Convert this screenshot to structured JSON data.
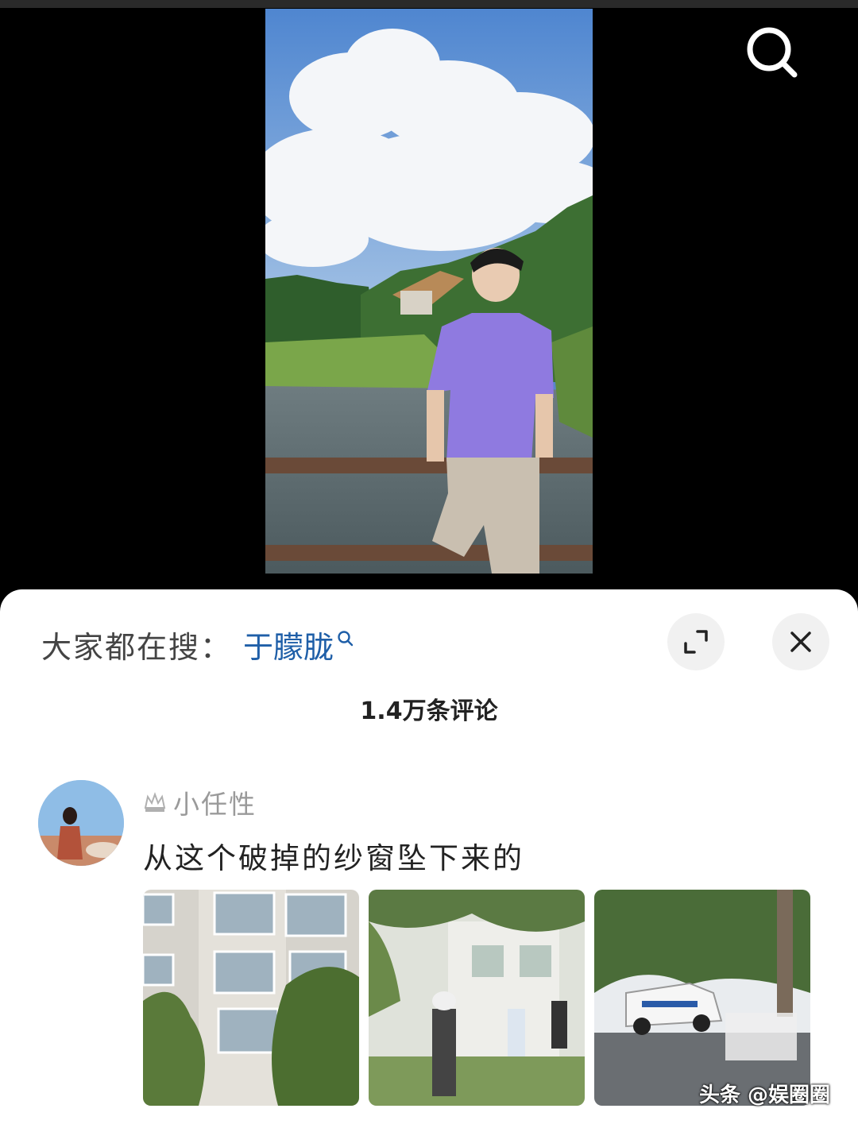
{
  "hot_search": {
    "prefix": "大家都在搜：",
    "term": "于朦胧"
  },
  "comments_header": {
    "count_label": "1.4万条评论"
  },
  "comment": {
    "username": "小任性",
    "text": "从这个破掉的纱窗坠下来的"
  },
  "watermark": "头条 @娱圈圈",
  "icons": {
    "search": "search-icon",
    "expand": "expand-icon",
    "close": "close-icon",
    "crown": "crown-icon"
  },
  "colors": {
    "hot_term": "#1f5fa8",
    "sheet_bg": "#ffffff",
    "video_bg": "#000000"
  }
}
